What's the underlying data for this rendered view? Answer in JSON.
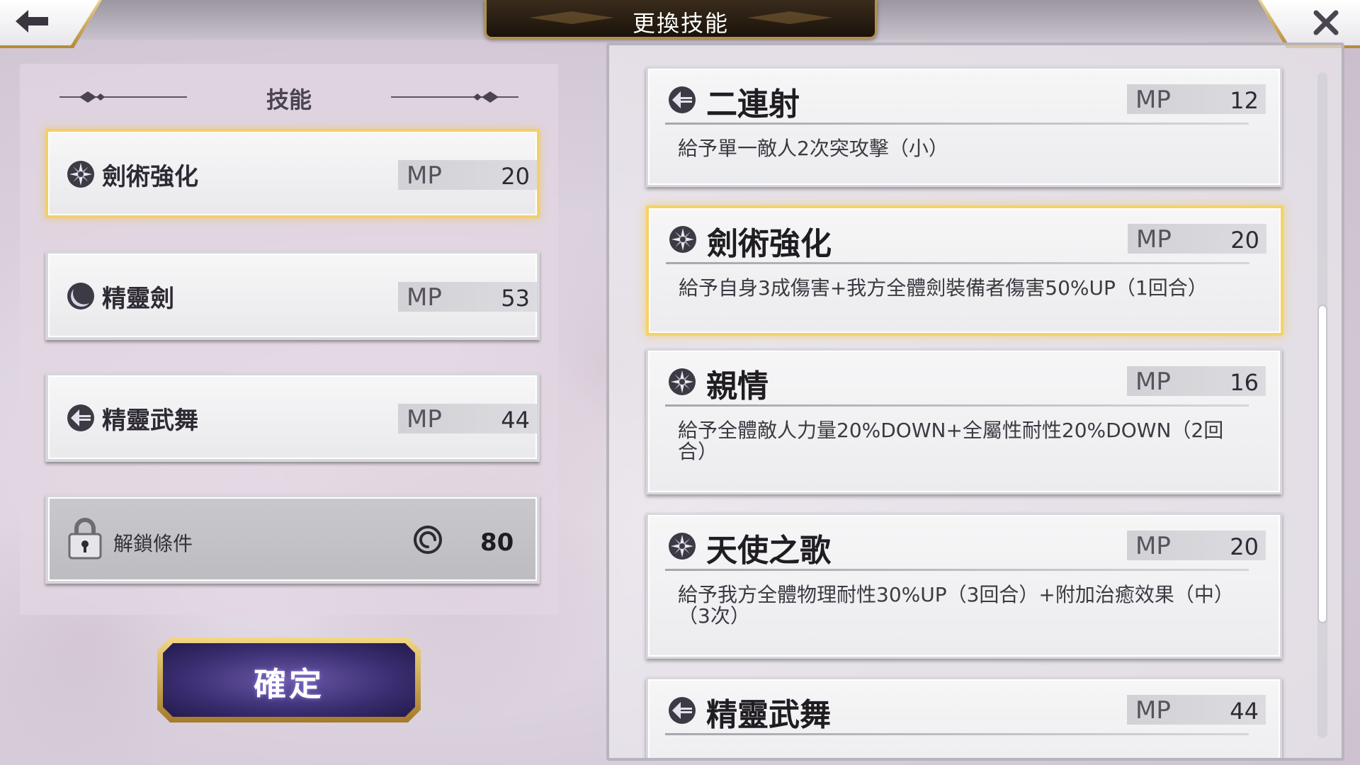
{
  "header": {
    "title": "更換技能"
  },
  "left_panel": {
    "title": "技能",
    "slots": [
      {
        "name": "劍術強化",
        "mp_label": "MP",
        "mp": "20",
        "icon": "holy-star-icon",
        "selected": true
      },
      {
        "name": "精靈劍",
        "mp_label": "MP",
        "mp": "53",
        "icon": "crescent-orb-icon"
      },
      {
        "name": "精靈武舞",
        "mp_label": "MP",
        "mp": "44",
        "icon": "arrow-emblem-icon"
      }
    ],
    "locked_slot": {
      "label": "解鎖條件",
      "value": "80",
      "icon": "swirl-icon"
    },
    "confirm_label": "確定"
  },
  "skill_list": [
    {
      "name": "二連射",
      "mp_label": "MP",
      "mp": "12",
      "icon": "arrow-emblem-icon",
      "desc": "給予單一敵人2次突攻擊（小）"
    },
    {
      "name": "劍術強化",
      "mp_label": "MP",
      "mp": "20",
      "icon": "holy-star-icon",
      "desc": "給予自身3成傷害+我方全體劍裝備者傷害50%UP（1回合）",
      "selected": true
    },
    {
      "name": "親情",
      "mp_label": "MP",
      "mp": "16",
      "icon": "holy-star-icon",
      "desc": "給予全體敵人力量20%DOWN+全屬性耐性20%DOWN（2回合）"
    },
    {
      "name": "天使之歌",
      "mp_label": "MP",
      "mp": "20",
      "icon": "holy-star-icon",
      "desc": "給予我方全體物理耐性30%UP（3回合）+附加治癒效果（中）（3次）"
    },
    {
      "name": "精靈武舞",
      "mp_label": "MP",
      "mp": "44",
      "icon": "arrow-emblem-icon",
      "desc": ""
    }
  ],
  "colors": {
    "selected_border": "#f2cf6a",
    "confirm_button": "#3a2d70",
    "title_plate": "#1a120a"
  }
}
